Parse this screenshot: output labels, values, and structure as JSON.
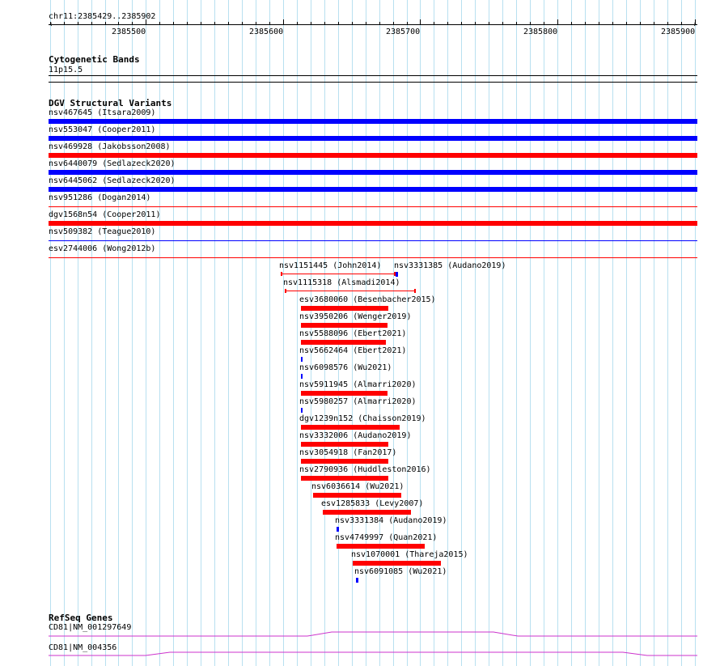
{
  "colors": {
    "grid": "#b8e0f0",
    "gain": "#0000ff",
    "loss": "#ff0000",
    "gene": "#cc33cc",
    "rule": "#000000"
  },
  "ruler": {
    "region": "chr11:2385429..2385902",
    "start": 2385429,
    "end": 2385902,
    "tick_labels": [
      "2385500",
      "2385600",
      "2385700",
      "2385800",
      "2385900"
    ],
    "tick_values": [
      2385500,
      2385600,
      2385700,
      2385800,
      2385900
    ]
  },
  "cytobands": {
    "title": "Cytogenetic Bands",
    "band": "11p15.5"
  },
  "dgv": {
    "title": "DGV Structural Variants",
    "wide": [
      {
        "label": "nsv467645 (Itsara2009)",
        "type": "gain",
        "thick": true
      },
      {
        "label": "nsv553047 (Cooper2011)",
        "type": "gain",
        "thick": true
      },
      {
        "label": "nsv469928 (Jakobsson2008)",
        "type": "loss",
        "thick": true
      },
      {
        "label": "nsv6440079 (Sedlazeck2020)",
        "type": "gain",
        "thick": true
      },
      {
        "label": "nsv6445062 (Sedlazeck2020)",
        "type": "gain",
        "thick": true
      },
      {
        "label": "nsv951286 (Dogan2014)",
        "type": "loss",
        "thick": false
      },
      {
        "label": "dgv1568n54 (Cooper2011)",
        "type": "loss",
        "thick": true
      },
      {
        "label": "nsv509382 (Teague2010)",
        "type": "gain",
        "thick": false
      },
      {
        "label": "esv2744006 (Wong2012b)",
        "type": "loss",
        "thick": false
      }
    ],
    "local": [
      {
        "label": "nsv1151445 (John2014)",
        "type": "loss",
        "style": "span",
        "start": 2385598,
        "end": 2385682
      },
      {
        "label": "nsv3331385 (Audano2019)",
        "type": "gain",
        "style": "block",
        "start": 2385682,
        "end": 2385684
      },
      {
        "label": "nsv1115318 (Alsmadi2014)",
        "type": "loss",
        "style": "span",
        "start": 2385601,
        "end": 2385697
      },
      {
        "label": "esv3680060 (Besenbacher2015)",
        "type": "loss",
        "style": "block",
        "start": 2385613,
        "end": 2385677
      },
      {
        "label": "nsv3950206 (Wenger2019)",
        "type": "loss",
        "style": "block",
        "start": 2385613,
        "end": 2385676
      },
      {
        "label": "nsv5588096 (Ebert2021)",
        "type": "loss",
        "style": "block",
        "start": 2385613,
        "end": 2385675
      },
      {
        "label": "nsv5662464 (Ebert2021)",
        "type": "gain",
        "style": "block",
        "start": 2385613,
        "end": 2385614
      },
      {
        "label": "nsv6098576 (Wu2021)",
        "type": "gain",
        "style": "block",
        "start": 2385613,
        "end": 2385614
      },
      {
        "label": "nsv5911945 (Almarri2020)",
        "type": "loss",
        "style": "block",
        "start": 2385613,
        "end": 2385676
      },
      {
        "label": "nsv5980257 (Almarri2020)",
        "type": "gain",
        "style": "block",
        "start": 2385613,
        "end": 2385614
      },
      {
        "label": "dgv1239n152 (Chaisson2019)",
        "type": "loss",
        "style": "block",
        "start": 2385613,
        "end": 2385685
      },
      {
        "label": "nsv3332006 (Audano2019)",
        "type": "loss",
        "style": "block",
        "start": 2385613,
        "end": 2385677
      },
      {
        "label": "nsv3054918 (Fan2017)",
        "type": "loss",
        "style": "block",
        "start": 2385613,
        "end": 2385677
      },
      {
        "label": "nsv2790936 (Huddleston2016)",
        "type": "loss",
        "style": "block",
        "start": 2385613,
        "end": 2385677
      },
      {
        "label": "nsv6036614 (Wu2021)",
        "type": "loss",
        "style": "block",
        "start": 2385622,
        "end": 2385686
      },
      {
        "label": "esv1285833 (Levy2007)",
        "type": "loss",
        "style": "block",
        "start": 2385629,
        "end": 2385693
      },
      {
        "label": "nsv3331384 (Audano2019)",
        "type": "gain",
        "style": "block",
        "start": 2385639,
        "end": 2385641
      },
      {
        "label": "nsv4749997 (Quan2021)",
        "type": "loss",
        "style": "block",
        "start": 2385639,
        "end": 2385703
      },
      {
        "label": "nsv1070001 (Thareja2015)",
        "type": "loss",
        "style": "block",
        "start": 2385651,
        "end": 2385715
      },
      {
        "label": "nsv6091085 (Wu2021)",
        "type": "gain",
        "style": "block",
        "start": 2385653,
        "end": 2385655
      }
    ]
  },
  "refseq": {
    "title": "RefSeq Genes",
    "genes": [
      {
        "label": "CD81|NM_001297649"
      },
      {
        "label": "CD81|NM_004356"
      }
    ]
  }
}
